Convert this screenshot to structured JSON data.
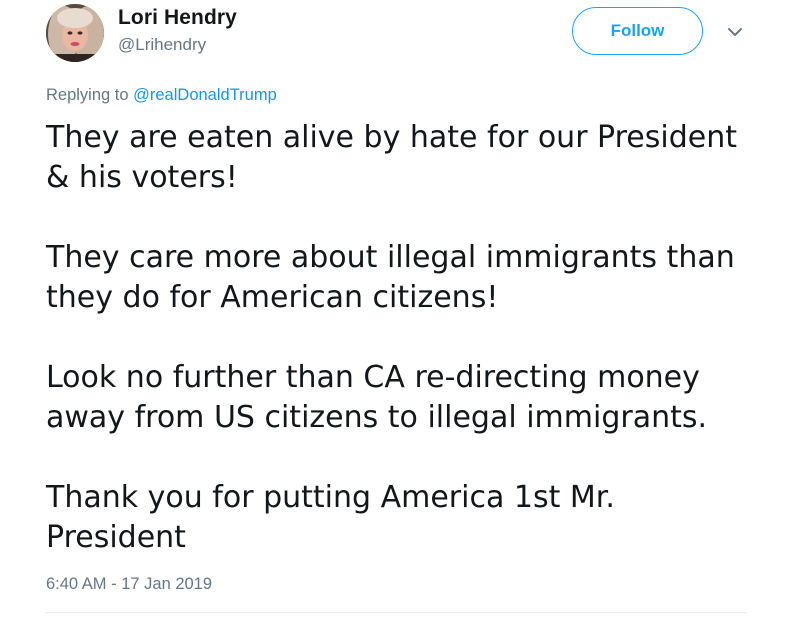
{
  "user": {
    "display_name": "Lori Hendry",
    "handle": "@Lrihendry"
  },
  "actions": {
    "follow_label": "Follow",
    "caret_icon": "chevron-down-icon"
  },
  "reply_context": {
    "prefix": "Replying to ",
    "mention": "@realDonaldTrump"
  },
  "tweet": {
    "paragraphs": [
      "They are eaten alive by hate for our President\n& his voters!",
      "They care more about illegal immigrants than\nthey do for American citizens!",
      "Look no further than CA re-directing money\naway from US citizens to illegal immigrants.",
      "Thank you for putting America 1st Mr.\nPresident"
    ],
    "timestamp": "6:40 AM - 17 Jan 2019"
  },
  "colors": {
    "accent": "#1da1f2",
    "mention": "#1b95e0",
    "secondary_text": "#657786",
    "primary_text": "#14171a"
  }
}
